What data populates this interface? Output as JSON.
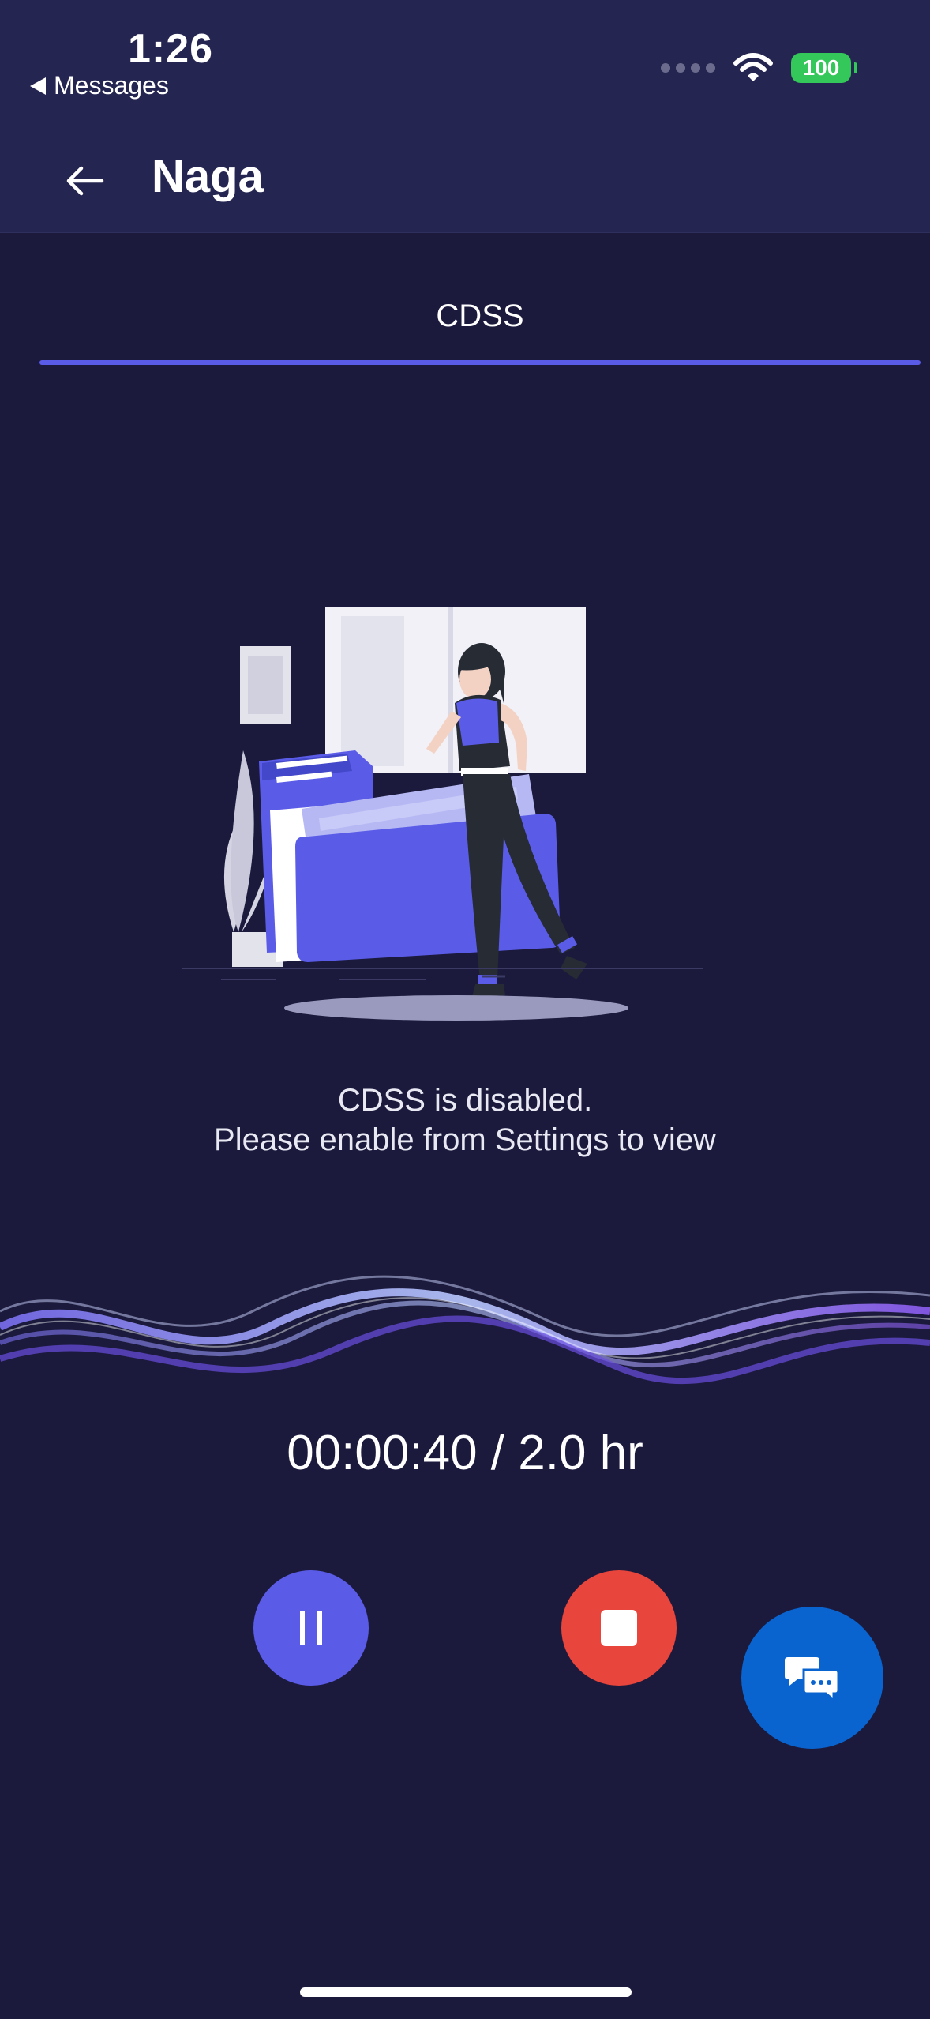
{
  "status_bar": {
    "time": "1:26",
    "back_app": "Messages",
    "battery": "100"
  },
  "nav": {
    "title": "Naga"
  },
  "tabs": [
    {
      "label": "CDSS"
    }
  ],
  "content": {
    "message_line1": "CDSS is disabled.",
    "message_line2": "Please enable from Settings to view"
  },
  "recorder": {
    "timer": "00:00:40 / 2.0 hr"
  },
  "icons": {
    "back": "arrow-left-icon",
    "pause": "pause-icon",
    "stop": "stop-icon",
    "chat": "chat-bubbles-icon",
    "wifi": "wifi-icon",
    "signal": "signal-dots-icon"
  },
  "colors": {
    "background": "#1b1a3c",
    "header": "#242550",
    "accent": "#5a5ce8",
    "stop": "#e8453c",
    "chat": "#0a64cf",
    "battery": "#34c759"
  }
}
